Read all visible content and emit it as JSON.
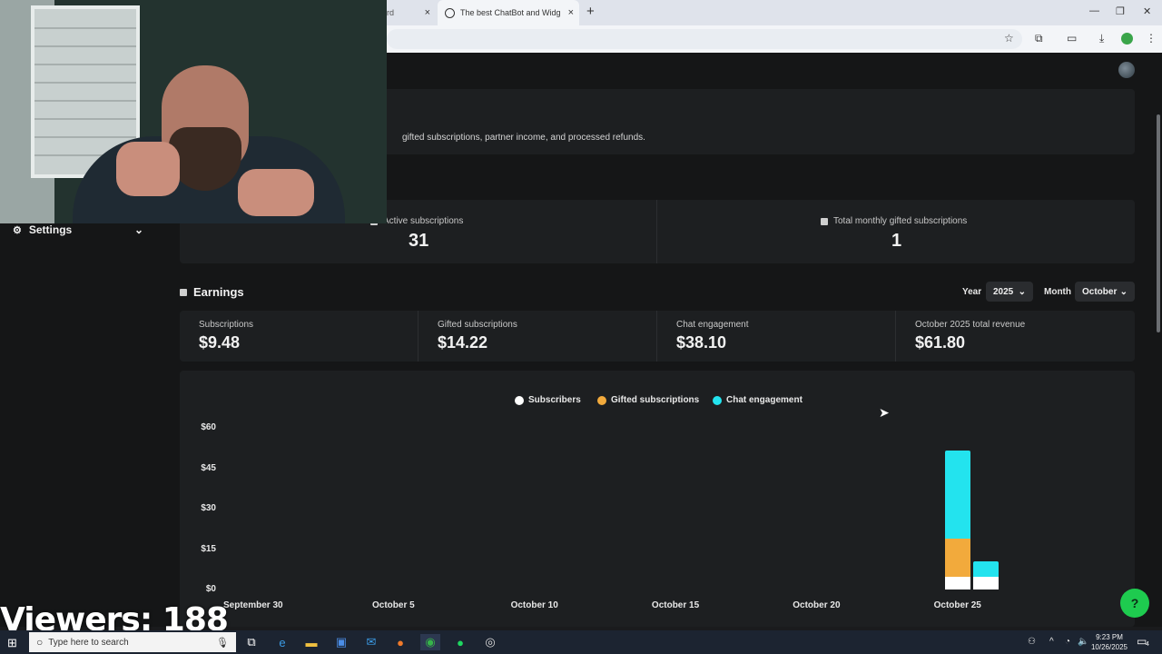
{
  "browser": {
    "tabs": [
      {
        "title": "rd",
        "close": "×"
      },
      {
        "title": "The best ChatBot and Widgets",
        "close": "×"
      }
    ],
    "new_tab": "+",
    "window_controls": [
      "—",
      "❐",
      "✕"
    ]
  },
  "sidebar": {
    "settings_label": "Settings",
    "chevron": "⌄"
  },
  "intro": {
    "text": "gifted subscriptions, partner income, and processed refunds."
  },
  "subscriptions": {
    "active_label": "Active subscriptions",
    "active_value": "31",
    "gifted_label": "Total monthly gifted subscriptions",
    "gifted_value": "1"
  },
  "earnings": {
    "title": "Earnings",
    "year_label": "Year",
    "year_value": "2025",
    "month_label": "Month",
    "month_value": "October",
    "stats": [
      {
        "label": "Subscriptions",
        "value": "$9.48"
      },
      {
        "label": "Gifted subscriptions",
        "value": "$14.22"
      },
      {
        "label": "Chat engagement",
        "value": "$38.10"
      },
      {
        "label": "October 2025 total revenue",
        "value": "$61.80"
      }
    ]
  },
  "chart_data": {
    "type": "bar",
    "stacked": true,
    "legend": [
      {
        "name": "Subscribers",
        "color": "#ffffff"
      },
      {
        "name": "Gifted subscriptions",
        "color": "#f2aa3c"
      },
      {
        "name": "Chat engagement",
        "color": "#23e3ee"
      }
    ],
    "y_ticks": [
      "$0",
      "$15",
      "$30",
      "$45",
      "$60"
    ],
    "ylim": [
      0,
      60
    ],
    "x_ticks": [
      "September 30",
      "October 5",
      "October 10",
      "October 15",
      "October 20",
      "October 25"
    ],
    "bars": [
      {
        "day_index": 25,
        "Subscribers": 4.74,
        "Gifted subscriptions": 14.22,
        "Chat engagement": 32.5
      },
      {
        "day_index": 26,
        "Subscribers": 4.74,
        "Gifted subscriptions": 0,
        "Chat engagement": 5.6
      }
    ],
    "legend_placement": "top-center",
    "grid": false
  },
  "overlay": {
    "viewers": "Viewers: 188"
  },
  "taskbar": {
    "search_placeholder": "Type here to search",
    "time": "9:23 PM",
    "date": "10/26/2025",
    "notification_count": "4"
  }
}
